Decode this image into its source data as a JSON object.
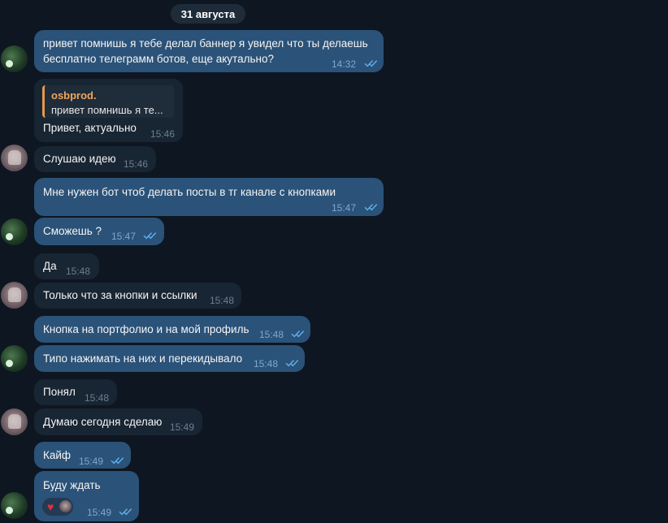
{
  "date_separator": "31 августа",
  "reply": {
    "author": "osbprod.",
    "quote": "привет помнишь я те..."
  },
  "messages": [
    {
      "line1": "привет помнишь я тебе делал баннер я увидел что ты делаешь",
      "line2": "бесплатно телеграмм ботов, еще акутально?",
      "time": "14:32"
    },
    {
      "text": "Привет, актуально",
      "time": "15:46"
    },
    {
      "text": "Слушаю идею",
      "time": "15:46"
    },
    {
      "text": "Мне нужен бот чтоб делать посты в тг канале с кнопками",
      "time": "15:47"
    },
    {
      "text": "Сможешь ?",
      "time": "15:47"
    },
    {
      "text": "Да",
      "time": "15:48"
    },
    {
      "text": "Только что за кнопки и ссылки",
      "time": "15:48"
    },
    {
      "text": "Кнопка на портфолио и на мой профиль",
      "time": "15:48"
    },
    {
      "text": "Типо нажимать на них и перекидывало",
      "time": "15:48"
    },
    {
      "text": "Понял",
      "time": "15:48"
    },
    {
      "text": "Думаю сегодня сделаю",
      "time": "15:49"
    },
    {
      "text": "Кайф",
      "time": "15:49"
    },
    {
      "text": "Буду ждать",
      "time": "15:49"
    }
  ],
  "icons": {
    "read_status": "double-check-icon",
    "reaction": "heart-icon"
  },
  "colors": {
    "background": "#0e1621",
    "outgoing_bubble": "#2b5278",
    "incoming_bubble": "#182533",
    "read_checks": "#5fb1ee",
    "reply_accent": "#e79a4a"
  }
}
